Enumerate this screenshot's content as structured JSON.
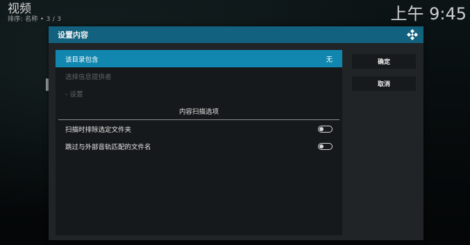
{
  "window": {
    "title": "视频",
    "subtitle": "排序: 名称  •  3 / 3",
    "clock": "上午 9:45"
  },
  "dialog": {
    "title": "设置内容",
    "rows": [
      {
        "label": "该目录包含",
        "value": "无",
        "state": "selected"
      },
      {
        "label": "选择信息提供者",
        "state": "disabled"
      },
      {
        "label": "- 设置",
        "state": "disabled"
      }
    ],
    "section_title": "内容扫描选项",
    "options": [
      {
        "label": "扫描时排除选定文件夹",
        "enabled": false
      },
      {
        "label": "跳过与外部音轨匹配的文件名",
        "enabled": false
      }
    ],
    "buttons": {
      "ok": "确定",
      "cancel": "取消"
    }
  },
  "colors": {
    "header": "#12627f",
    "selected_row": "#1187b0",
    "panel": "#16191b",
    "dialog": "#202426"
  },
  "icons": {
    "header": "kodi-logo-icon"
  }
}
